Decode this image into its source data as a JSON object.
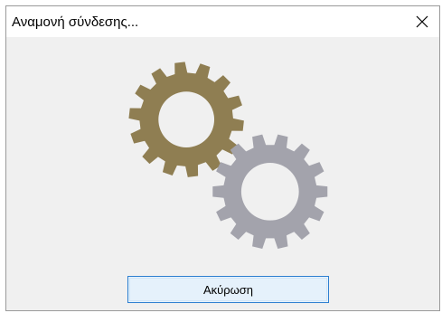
{
  "window": {
    "title": "Αναμονή σύνδεσης...",
    "close_icon": "close-icon"
  },
  "animation": {
    "icons": [
      "gear-icon-gold",
      "gear-icon-gray"
    ],
    "colors": {
      "gold_gear": "#8f7e52",
      "gray_gear": "#a3a3ac",
      "background": "#f0f0f0"
    }
  },
  "actions": {
    "cancel_label": "Ακύρωση",
    "cancel_colors": {
      "background": "#e5f1fb",
      "border": "#2d7fd0"
    }
  }
}
